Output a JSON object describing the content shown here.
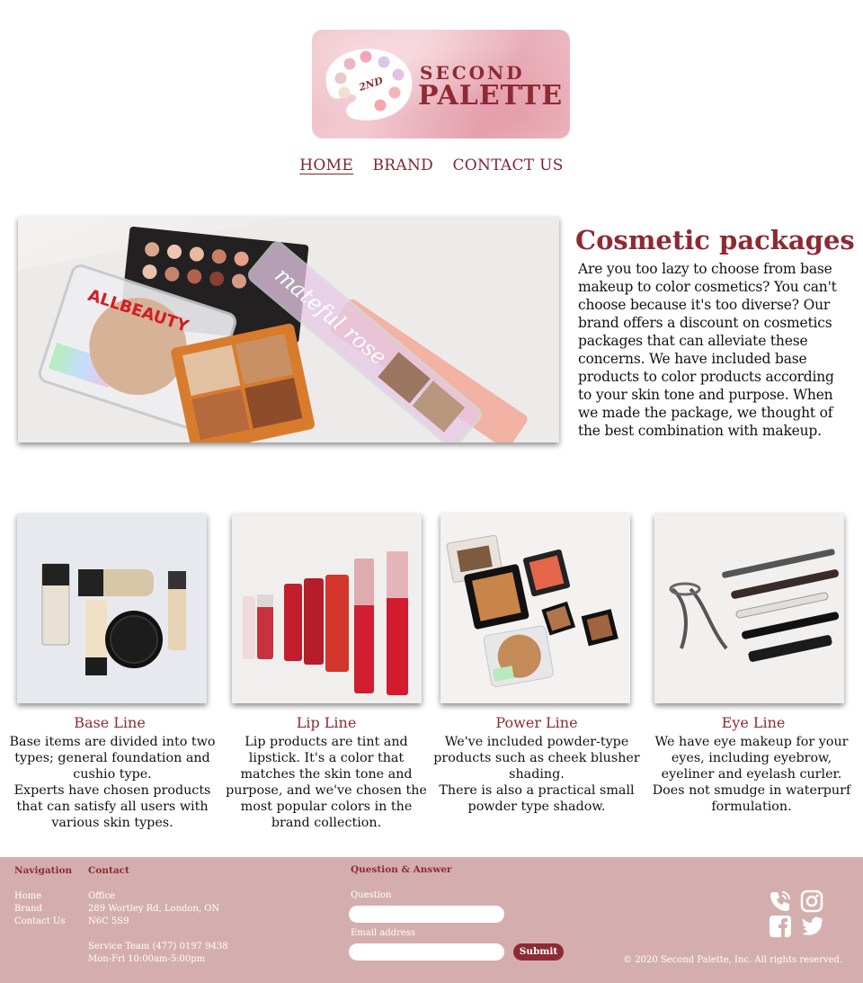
{
  "brand": {
    "logo_small": "SECOND",
    "logo_big": "PALETTE",
    "logo_badge": "2ND"
  },
  "nav": {
    "items": [
      {
        "label": "HOME",
        "active": true
      },
      {
        "label": "BRAND",
        "active": false
      },
      {
        "label": "CONTACT US",
        "active": false
      }
    ]
  },
  "hero": {
    "title": "Cosmetic packages",
    "text": "Are you too lazy to choose from base makeup to color cosmetics? You can't choose because it's too diverse? Our brand offers a discount on cosmetics packages that can alleviate these concerns. We have included base products to color products according to your skin tone and purpose. When we made the package, we thought of the best combination with makeup.",
    "image_text": "mateful rose"
  },
  "products": [
    {
      "title": "Base Line",
      "text": "Base items are divided into two types; general foundation and cushio type.\nExperts have chosen products that can satisfy all users with various skin types."
    },
    {
      "title": "Lip Line",
      "text": "Lip products are tint and lipstick. It's a color that matches the skin tone and purpose, and we've chosen the most popular colors in the brand collection."
    },
    {
      "title": "Power Line",
      "text": "We've included powder-type products such as cheek blusher shading.\nThere is also a practical small powder type shadow."
    },
    {
      "title": "Eye Line",
      "text": "We have eye makeup for your eyes, including eyebrow, eyeliner and eyelash curler. Does not smudge in waterpurf formulation."
    }
  ],
  "footer": {
    "navigation_heading": "Navigation",
    "navigation_links": [
      "Home",
      "Brand",
      "Contact Us"
    ],
    "contact_heading": "Contact",
    "contact_office_label": "Office",
    "contact_address_1": "289 Wortley Rd, London, ON",
    "contact_address_2": "N6C 5S9",
    "contact_service": "Service Team (477) 0197 9438",
    "contact_hours": "Mon-Fri 10:00am-5:00pm",
    "qa_heading": "Question & Answer",
    "question_label": "Question",
    "question_value": "",
    "email_label": "Email address",
    "email_value": "",
    "submit_label": "Submit",
    "copyright": "© 2020 Second Palette, Inc. All rights reserved.",
    "social_icons": [
      "phone-icon",
      "instagram-icon",
      "facebook-icon",
      "twitter-icon"
    ]
  },
  "colors": {
    "accent": "#8e2a34",
    "footer_bg": "#d4aeae",
    "logo_bg": "#eebbc4"
  }
}
